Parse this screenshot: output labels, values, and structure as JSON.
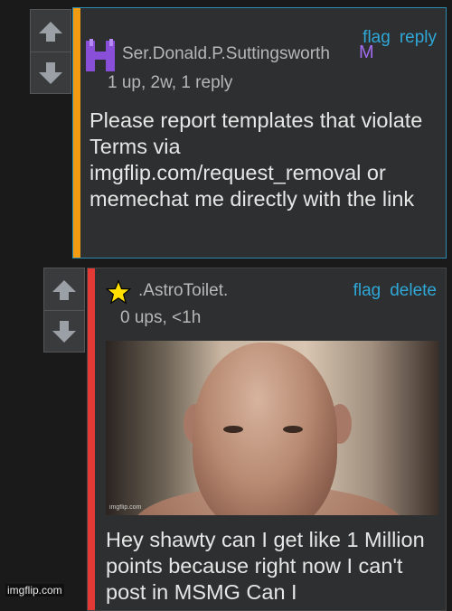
{
  "comments": [
    {
      "username": "Ser.Donald.P.Suttingsworth",
      "badge": "M",
      "meta": "1 up, 2w, 1 reply",
      "actions": [
        "flag",
        "reply"
      ],
      "text": "Please report templates that violate Terms via imgflip.com/request_removal or memechat me directly with the link",
      "bar_color": "#f39c12",
      "avatar_icon": "h-logo-icon"
    },
    {
      "username": ".AstroToilet.",
      "meta": "0 ups, <1h",
      "actions": [
        "flag",
        "delete"
      ],
      "text": "Hey shawty can I get like 1 Million points because right now I can't post in MSMG Can I",
      "bar_color": "#e53935",
      "avatar_icon": "star-icon",
      "image_watermark": "imgflip.com"
    }
  ],
  "footer_watermark": "imgflip.com",
  "colors": {
    "link": "#2fa8d8",
    "mod_badge": "#a06cf0"
  }
}
